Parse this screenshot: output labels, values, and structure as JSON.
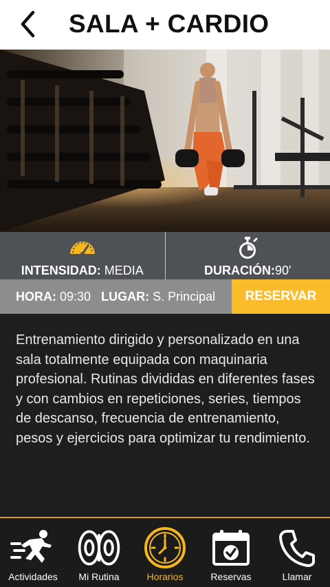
{
  "header": {
    "title": "SALA + CARDIO"
  },
  "stats": {
    "intensity_label": "INTENSIDAD:",
    "intensity_value": "MEDIA",
    "duration_label": "DURACIÓN:",
    "duration_value": "90'"
  },
  "info": {
    "hour_label": "HORA:",
    "hour_value": "09:30",
    "place_label": "LUGAR:",
    "place_value": "S. Principal",
    "reserve_label": "RESERVAR"
  },
  "description": "Entrenamiento dirigido y personalizado en una sala totalmente equipada con maquinaria profesional. Rutinas divididas en diferentes fases y con cambios en repeticiones, series, tiempos de descanso, frecuencia de entrenamiento, pesos y ejercicios para optimizar tu rendimiento.",
  "nav": {
    "items": [
      {
        "label": "Actividades",
        "icon": "running-person-icon"
      },
      {
        "label": "Mi Rutina",
        "icon": "weight-plates-icon"
      },
      {
        "label": "Horarios",
        "icon": "clock-icon"
      },
      {
        "label": "Reservas",
        "icon": "calendar-check-icon"
      },
      {
        "label": "Llamar",
        "icon": "phone-icon"
      }
    ],
    "active_index": 2
  },
  "colors": {
    "accent": "#f6b71e",
    "reserve_button": "#fbbc2c",
    "stats_bg": "#4e5156",
    "info_bar_bg": "#8d8d8d",
    "body_bg": "#1e1e1e"
  }
}
